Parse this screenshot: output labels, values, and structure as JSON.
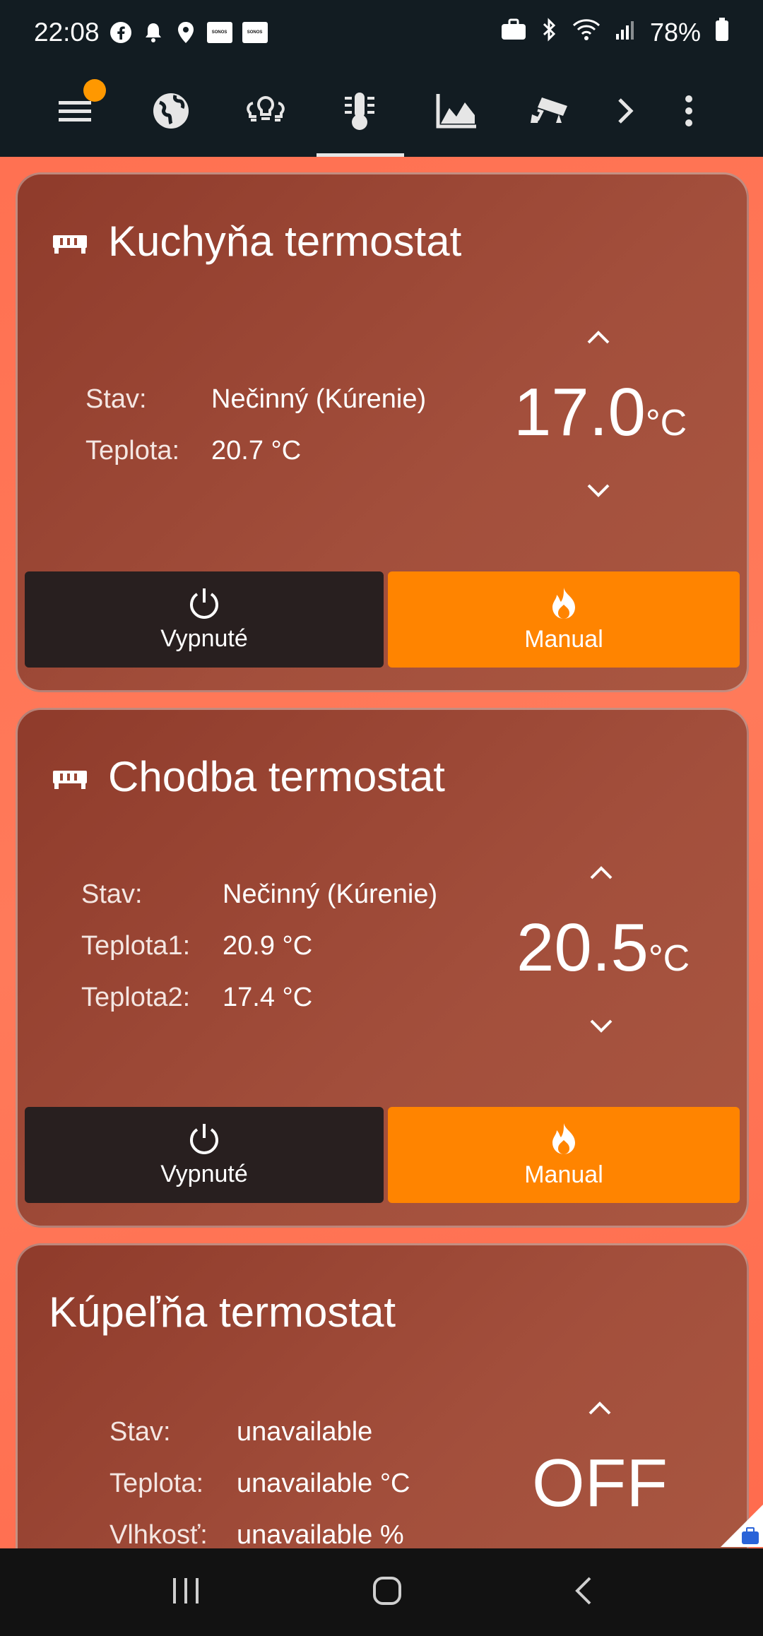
{
  "status_bar": {
    "time": "22:08",
    "battery": "78%",
    "icons_left": [
      "facebook-icon",
      "bell-icon",
      "location-icon",
      "sonos-icon",
      "sonos-icon"
    ],
    "sonos_text": "SONOS",
    "icons_right": [
      "briefcase-icon",
      "bluetooth-icon",
      "wifi-icon",
      "signal-icon",
      "battery-icon"
    ]
  },
  "appbar": {
    "tabs": [
      "menu",
      "globe",
      "lights",
      "thermostat",
      "graph",
      "camera"
    ],
    "active_tab": "thermostat",
    "accent_color": "#ff9800"
  },
  "cards": [
    {
      "title": "Kuchyňa termostat",
      "has_icon": true,
      "rows": [
        {
          "label": "Stav:",
          "value": "Nečinný (Kúrenie)"
        },
        {
          "label": "Teplota:",
          "value": "20.7 °C"
        }
      ],
      "setpoint": "17.0",
      "unit": "°C",
      "off_label": "Vypnuté",
      "manual_label": "Manual"
    },
    {
      "title": "Chodba termostat",
      "has_icon": true,
      "rows": [
        {
          "label": "Stav:",
          "value": "Nečinný (Kúrenie)"
        },
        {
          "label": "Teplota1:",
          "value": "20.9 °C"
        },
        {
          "label": "Teplota2:",
          "value": "17.4 °C"
        }
      ],
      "setpoint": "20.5",
      "unit": "°C",
      "off_label": "Vypnuté",
      "manual_label": "Manual"
    },
    {
      "title": "Kúpeľňa termostat",
      "has_icon": false,
      "rows": [
        {
          "label": "Stav:",
          "value": "unavailable"
        },
        {
          "label": "Teplota:",
          "value": "unavailable °C"
        },
        {
          "label": "Vlhkosť:",
          "value": "unavailable %"
        }
      ],
      "setpoint": "OFF"
    }
  ],
  "colors": {
    "manual": "#ff8400",
    "off": "#281f1f",
    "bar": "#121c22"
  }
}
